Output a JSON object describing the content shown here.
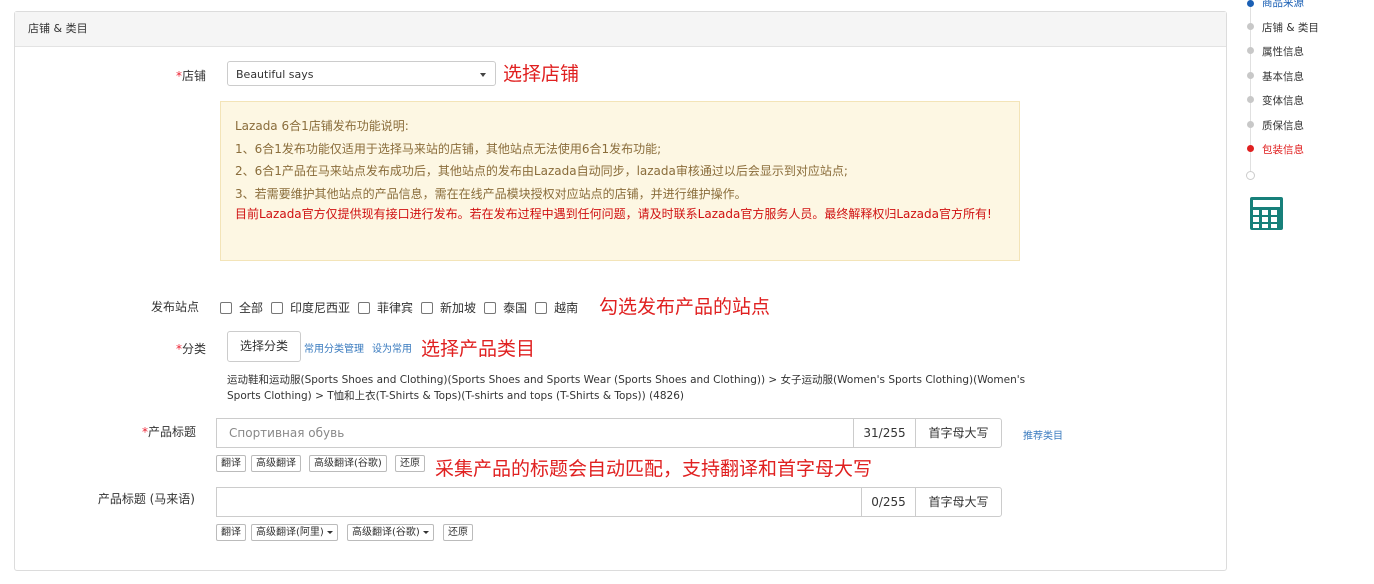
{
  "panel": {
    "title": "店铺 & 类目"
  },
  "shop": {
    "label": "店铺",
    "required": "*",
    "value": "Beautiful says",
    "annotation": "选择店铺"
  },
  "notice": {
    "title": "Lazada 6合1店铺发布功能说明:",
    "lines": [
      "1、6合1发布功能仅适用于选择马来站的店铺，其他站点无法使用6合1发布功能;",
      "2、6合1产品在马来站点发布成功后，其他站点的发布由Lazada自动同步，lazada审核通过以后会显示到对应站点;",
      "3、若需要维护其他站点的产品信息，需在在线产品模块授权对应站点的店铺，并进行维护操作。"
    ],
    "warning": "目前Lazada官方仅提供现有接口进行发布。若在发布过程中遇到任何问题，请及时联系Lazada官方服务人员。最终解释权归Lazada官方所有!"
  },
  "sites": {
    "label": "发布站点",
    "options": [
      "全部",
      "印度尼西亚",
      "菲律宾",
      "新加坡",
      "泰国",
      "越南"
    ],
    "annotation": "勾选发布产品的站点"
  },
  "category": {
    "label": "分类",
    "required": "*",
    "button": "选择分类",
    "link_manage": "常用分类管理",
    "link_set": "设为常用",
    "annotation": "选择产品类目",
    "path": "运动鞋和运动服(Sports Shoes and Clothing)(Sports Shoes and Sports Wear (Sports Shoes and Clothing)) > 女子运动服(Women's Sports Clothing)(Women's Sports Clothing) > T恤和上衣(T-Shirts & Tops)(T-shirts and tops (T-Shirts & Tops)) (4826)"
  },
  "title_field": {
    "label": "产品标题",
    "required": "*",
    "value": "Спортивная обувь",
    "counter": "31/255",
    "capitalize": "首字母大写",
    "recommend": "推荐类目",
    "buttons": [
      "翻译",
      "高级翻译",
      "高级翻译(谷歌)",
      "还原"
    ],
    "annotation": "采集产品的标题会自动匹配，支持翻译和首字母大写"
  },
  "title_malay": {
    "label": "产品标题 (马来语)",
    "value": "",
    "counter": "0/255",
    "capitalize": "首字母大写",
    "buttons": [
      "翻译",
      "高级翻译(阿里)",
      "高级翻译(谷歌)",
      "还原"
    ]
  },
  "nav": {
    "items": [
      "商品来源",
      "店铺 & 类目",
      "属性信息",
      "基本信息",
      "变体信息",
      "质保信息",
      "包装信息"
    ],
    "active_color": "#1a5fb4",
    "error_color": "#e02020"
  },
  "calculator_icon": "calculator-icon"
}
